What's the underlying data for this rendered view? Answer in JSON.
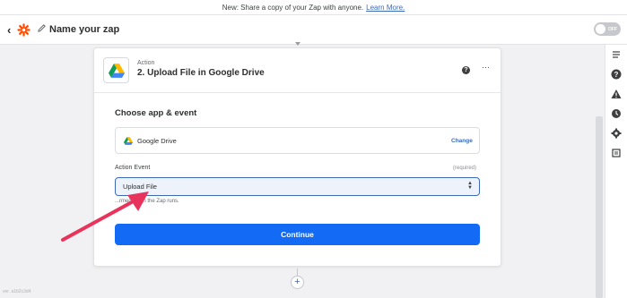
{
  "banner": {
    "text": "New: Share a copy of your Zap with anyone.",
    "link": "Learn More."
  },
  "topbar": {
    "back": "‹",
    "zap_name": "Name your zap",
    "toggle_label": "OFF"
  },
  "step": {
    "kind": "Action",
    "title": "2. Upload File in Google Drive",
    "help": "?",
    "more": "···"
  },
  "choose": {
    "heading": "Choose app & event",
    "app_name": "Google Drive",
    "change_label": "Change"
  },
  "event": {
    "label": "Action Event",
    "required": "(required)",
    "value": "Upload File",
    "hint": "...rmed when the Zap runs."
  },
  "continue_label": "Continue",
  "add_step": "+",
  "watermark": "ver. a1b2c3d4",
  "colors": {
    "primary": "#136bf5",
    "link": "#3d6ab4",
    "arrow": "#e8345c",
    "zapier_orange": "#ff4a00"
  },
  "icons": [
    "back-chevron-icon",
    "zapier-logo-icon",
    "pencil-icon",
    "google-drive-icon",
    "help-icon",
    "more-icon",
    "notes-icon",
    "question-icon",
    "warning-icon",
    "history-icon",
    "settings-icon",
    "versions-icon",
    "plus-icon",
    "select-caret-icon"
  ]
}
